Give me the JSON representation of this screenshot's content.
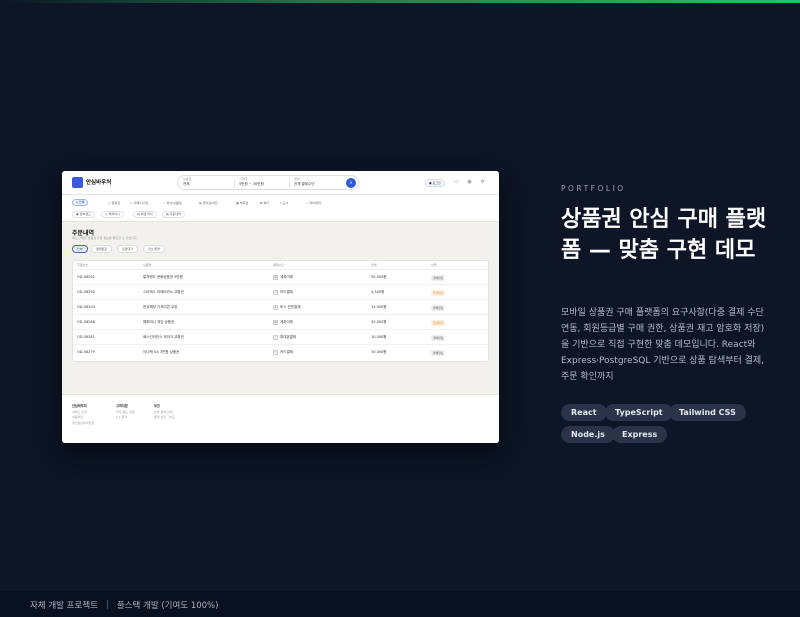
{
  "mockup": {
    "logo": "안심바우처",
    "search": {
      "seg1_label": "상품권",
      "seg1_value": "전체",
      "seg2_label": "가격대",
      "seg2_value": "5만원 ~ 30만원",
      "seg3_label": "결제",
      "seg3_value": "전체 결제수단"
    },
    "header_button": "로그인",
    "categories_row1": [
      "전체",
      "문화권",
      "카페/디저트",
      "외식/상품권",
      "편의점/마트",
      "백화점",
      "뷰티",
      "도서",
      "케어/레저"
    ],
    "categories_row2": [
      "컬쳐랜드",
      "해피머니",
      "북앤 라이",
      "주문내역"
    ],
    "page_title": "주문내역",
    "page_subtitle": "최근 구매한 상품권 주문 정보를 확인할 수 있습니다",
    "filter_tabs": [
      "전체",
      "결제완료",
      "입금대기",
      "취소/환불"
    ],
    "table": {
      "headers": [
        "주문번호",
        "상품명",
        "결제수단",
        "금액",
        "상태"
      ],
      "rows": [
        {
          "id": "OD-58291",
          "name": "컬쳐랜드 문화상품권 5만원",
          "pay": "계좌이체",
          "amount": "50,000원",
          "status": "결제완료"
        },
        {
          "id": "OD-58290",
          "name": "스타벅스 아메리카노 교환권",
          "pay": "카드결제",
          "amount": "4,500원",
          "status": "입금대기"
        },
        {
          "id": "OD-58294",
          "name": "한국해양 기프티콘 쿠폰",
          "pay": "토스 간편결제",
          "amount": "15,000원",
          "status": "결제완료"
        },
        {
          "id": "OD-58288",
          "name": "해피머니 게임 상품권",
          "pay": "계좌이체",
          "amount": "30,000원",
          "status": "입금대기"
        },
        {
          "id": "OD-58281",
          "name": "배스킨라빈스 케이크 교환권",
          "pay": "휴대폰결제",
          "amount": "10,000원",
          "status": "결제완료"
        },
        {
          "id": "OD-58279",
          "name": "이니텍 G4 3만원 상품권",
          "pay": "카드결제",
          "amount": "30,000원",
          "status": "결제완료"
        }
      ]
    },
    "footer": {
      "col1": {
        "title": "안심바우처",
        "lines": [
          "서비스 소개",
          "이용약관",
          "개인정보처리방침"
        ]
      },
      "col2": {
        "title": "고객지원",
        "lines": [
          "자주 묻는 질문",
          "1:1 문의"
        ]
      },
      "col3": {
        "title": "보안",
        "lines": [
          "보안 정책 안내",
          "결제 보안 가이드"
        ]
      }
    }
  },
  "eyebrow": "PORTFOLIO",
  "title": "상품권 안심 구매 플랫폼 — 맞춤 구현 데모",
  "description": "모바일 상품권 구매 플랫폼의 요구사항(다중 결제 수단 연동, 회원등급별 구매 권한, 상품권 재고 암호화 저장)을 기반으로 직접 구현한 맞춤 데모입니다. React와 Express·PostgreSQL 기반으로 상품 탐색부터 결제, 주문 확인까지",
  "tags": [
    "React",
    "TypeScript",
    "Tailwind CSS",
    "Node.js",
    "Express"
  ],
  "footer_note": {
    "left": "자체 개발 프로젝트",
    "right": "풀스택 개발 (기여도 100%)"
  },
  "colors": {
    "background": "#0d1526",
    "accent": "#3b5bdb",
    "tag_bg": "#2a3347"
  }
}
